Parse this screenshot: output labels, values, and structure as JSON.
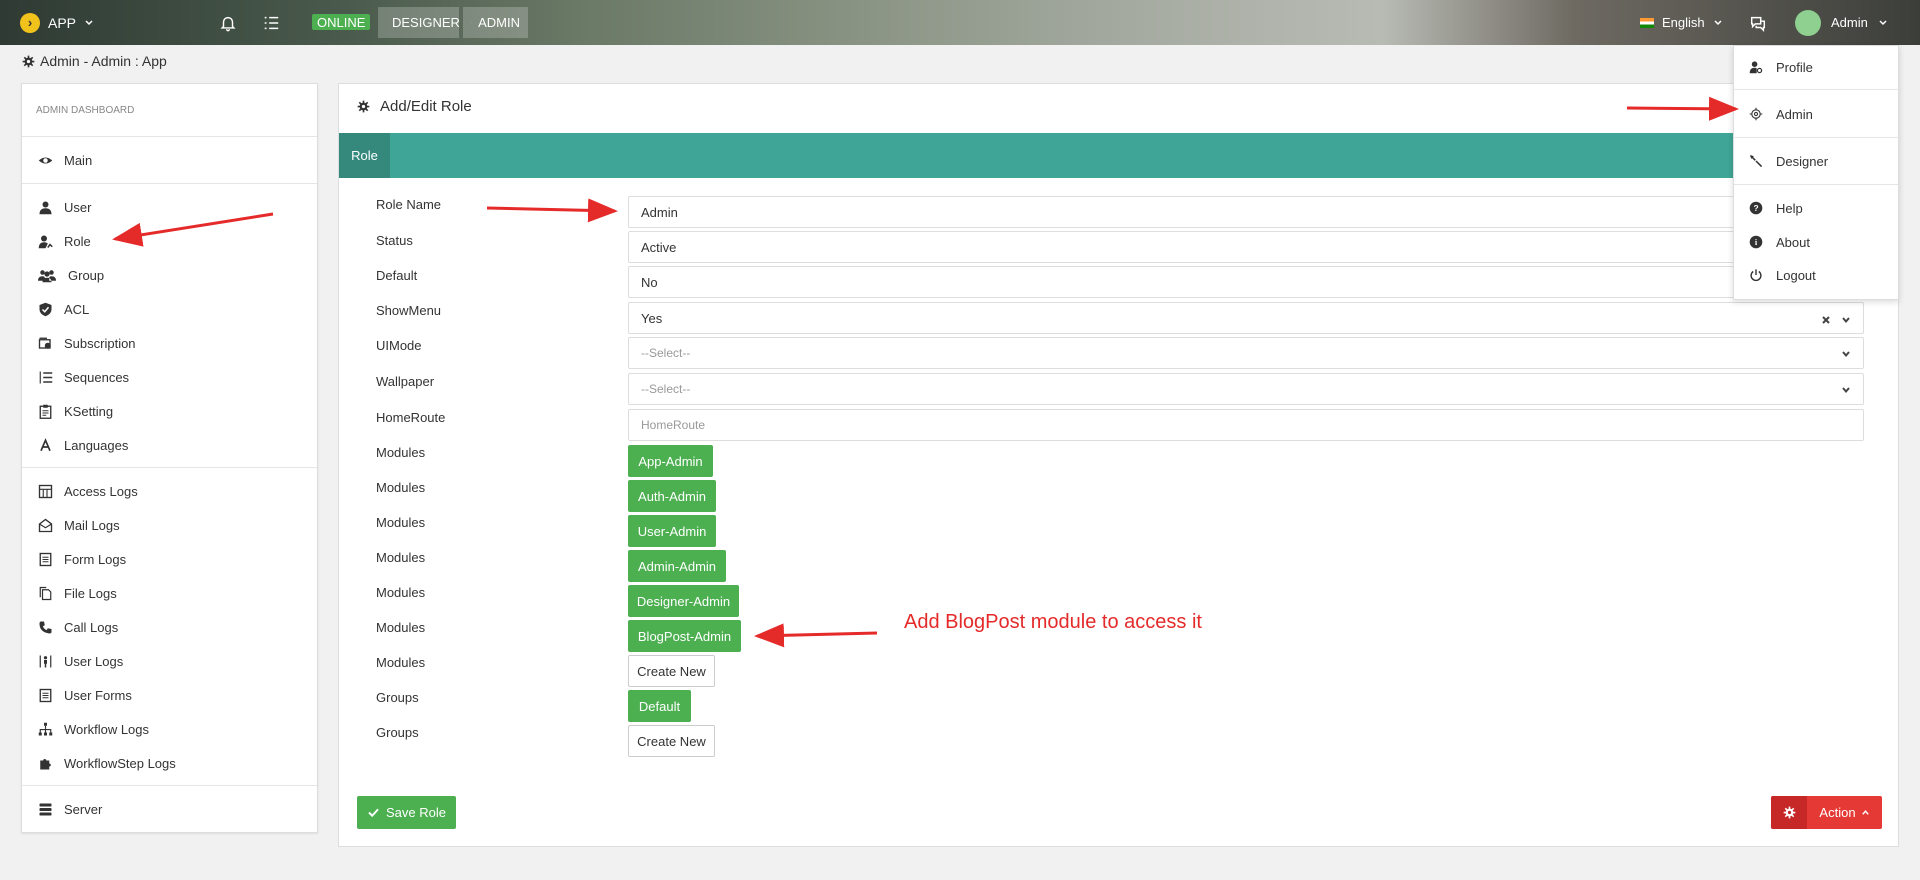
{
  "topbar": {
    "app_label": "APP",
    "online_badge": "ONLINE",
    "designer_label": "DESIGNER",
    "admin_label": "ADMIN",
    "language": "English",
    "user_name": "Admin"
  },
  "breadcrumb": "Admin - Admin : App",
  "sidebar": {
    "header": "ADMIN DASHBOARD",
    "items": [
      {
        "label": "Main",
        "icon": "eye-icon"
      },
      {
        "label": "User",
        "icon": "user-icon"
      },
      {
        "label": "Role",
        "icon": "user-role-icon"
      },
      {
        "label": "Group",
        "icon": "group-icon"
      },
      {
        "label": "ACL",
        "icon": "shield-icon"
      },
      {
        "label": "Subscription",
        "icon": "subscription-icon"
      },
      {
        "label": "Sequences",
        "icon": "list-ordered-icon"
      },
      {
        "label": "KSetting",
        "icon": "clipboard-icon"
      },
      {
        "label": "Languages",
        "icon": "font-icon"
      },
      {
        "label": "Access Logs",
        "icon": "table-icon"
      },
      {
        "label": "Mail Logs",
        "icon": "envelope-open-icon"
      },
      {
        "label": "Form Logs",
        "icon": "form-icon"
      },
      {
        "label": "File Logs",
        "icon": "files-icon"
      },
      {
        "label": "Call Logs",
        "icon": "phone-icon"
      },
      {
        "label": "User Logs",
        "icon": "user-door-icon"
      },
      {
        "label": "User Forms",
        "icon": "form-icon"
      },
      {
        "label": "Workflow Logs",
        "icon": "sitemap-icon"
      },
      {
        "label": "WorkflowStep Logs",
        "icon": "puzzle-icon"
      },
      {
        "label": "Server",
        "icon": "server-icon"
      }
    ]
  },
  "main": {
    "title": "Add/Edit Role",
    "tab": "Role",
    "fields": {
      "role_name": {
        "label": "Role Name",
        "value": "Admin"
      },
      "status": {
        "label": "Status",
        "value": "Active"
      },
      "default": {
        "label": "Default",
        "value": "No"
      },
      "showmenu": {
        "label": "ShowMenu",
        "value": "Yes"
      },
      "uimode": {
        "label": "UIMode",
        "value": "--Select--"
      },
      "wallpaper": {
        "label": "Wallpaper",
        "value": "--Select--"
      },
      "homeroute": {
        "label": "HomeRoute",
        "placeholder": "HomeRoute"
      }
    },
    "modules_label": "Modules",
    "modules": [
      "App-Admin",
      "Auth-Admin",
      "User-Admin",
      "Admin-Admin",
      "Designer-Admin",
      "BlogPost-Admin"
    ],
    "create_new": "Create New",
    "groups_label": "Groups",
    "groups": [
      "Default"
    ],
    "save_label": "Save Role",
    "action_label": "Action"
  },
  "dropdown": {
    "items": [
      {
        "label": "Profile",
        "icon": "user-gear-icon"
      },
      {
        "label": "Admin",
        "icon": "gear-icon"
      },
      {
        "label": "Designer",
        "icon": "tools-icon"
      },
      {
        "label": "Help",
        "icon": "question-icon"
      },
      {
        "label": "About",
        "icon": "info-icon"
      },
      {
        "label": "Logout",
        "icon": "power-icon"
      }
    ]
  },
  "annotation": "Add BlogPost module to access it",
  "colors": {
    "teal_bar": "#3fa596",
    "green_button": "#4caf50",
    "red_button": "#e53935",
    "annotation_red": "#e52a2a"
  }
}
